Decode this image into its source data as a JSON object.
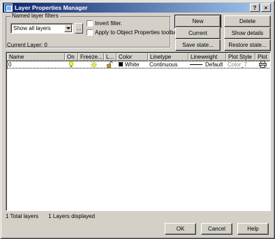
{
  "window": {
    "title": "Layer Properties Manager",
    "help_button": "?",
    "close_button": "×"
  },
  "filters": {
    "group_label": "Named layer filters",
    "selected": "Show all layers",
    "ellipsis": "...",
    "invert_label": "Invert filter.",
    "apply_label": "Apply to Object Properties toolbar."
  },
  "buttons": {
    "new": "New",
    "delete": "Delete",
    "current": "Current",
    "show_details": "Show details",
    "save_state": "Save state...",
    "restore_state": "Restore state..."
  },
  "current_layer": "Current Layer:  0",
  "table": {
    "columns": [
      "Name",
      "On",
      "Freeze...",
      "L...",
      "Color",
      "Linetype",
      "Lineweight",
      "Plot Style",
      "Plot"
    ],
    "rows": [
      {
        "name": "0",
        "on": "bulb-on-icon",
        "freeze": "sun-icon",
        "lock": "unlocked-icon",
        "color_name": "White",
        "color_swatch": "#000000",
        "linetype": "Continuous",
        "lineweight": "Default",
        "plot_style": "Color_7",
        "plot": "printer-icon"
      }
    ]
  },
  "status": {
    "total": "1 Total layers",
    "displayed": "1 Layers displayed"
  },
  "footer": {
    "ok": "OK",
    "cancel": "Cancel",
    "help": "Help"
  },
  "colors": {
    "title_gradient_start": "#0a246a",
    "title_gradient_end": "#a6caf0",
    "face": "#d4d0c8",
    "plot_style_text": "#808080"
  }
}
